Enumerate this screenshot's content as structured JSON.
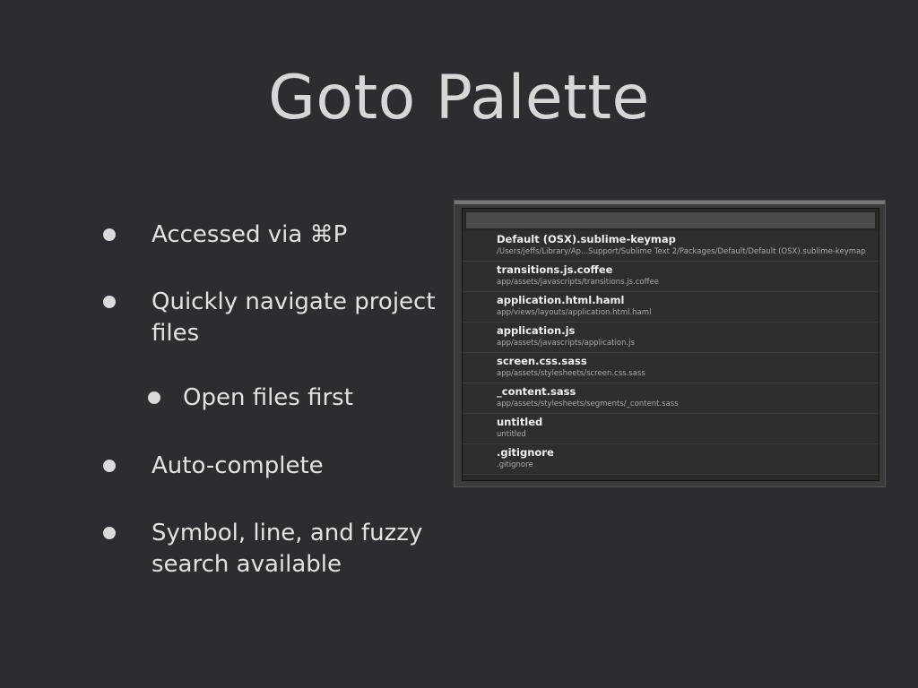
{
  "slide": {
    "title": "Goto Palette",
    "bullets": [
      {
        "text": "Accessed via ⌘P",
        "level": 1
      },
      {
        "text": "Quickly navigate project files",
        "level": 1
      },
      {
        "text": "Open files first",
        "level": 2
      },
      {
        "text": "Auto-complete",
        "level": 1
      },
      {
        "text": "Symbol, line, and fuzzy search available",
        "level": 1
      }
    ]
  },
  "palette": {
    "search_value": "",
    "items": [
      {
        "name": "Default (OSX).sublime-keymap",
        "path": "/Users/jeffs/Library/Ap...Support/Sublime Text 2/Packages/Default/Default (OSX).sublime-keymap"
      },
      {
        "name": "transitions.js.coffee",
        "path": "app/assets/javascripts/transitions.js.coffee"
      },
      {
        "name": "application.html.haml",
        "path": "app/views/layouts/application.html.haml"
      },
      {
        "name": "application.js",
        "path": "app/assets/javascripts/application.js"
      },
      {
        "name": "screen.css.sass",
        "path": "app/assets/stylesheets/screen.css.sass"
      },
      {
        "name": "_content.sass",
        "path": "app/assets/stylesheets/segments/_content.sass"
      },
      {
        "name": "untitled",
        "path": "untitled"
      },
      {
        "name": ".gitignore",
        "path": ".gitignore"
      }
    ]
  }
}
